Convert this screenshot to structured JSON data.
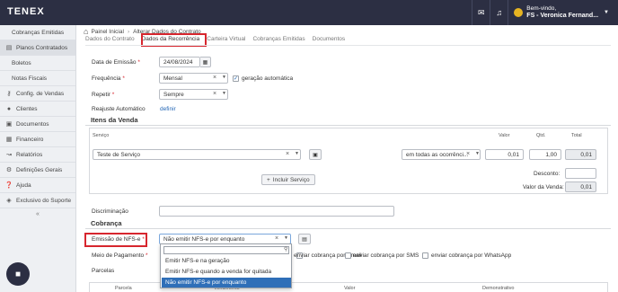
{
  "header": {
    "logo": "TENEX",
    "user": {
      "greeting": "Bem-vindo,",
      "name": "FS - Veronica Fernand..."
    }
  },
  "sidebar": {
    "items": [
      {
        "label": "Cobranças Emitidas",
        "icon": ""
      },
      {
        "label": "Planos Contratados",
        "icon": "subscriptions-icon"
      },
      {
        "label": "Boletos",
        "icon": ""
      },
      {
        "label": "Notas Fiscais",
        "icon": ""
      },
      {
        "label": "Config. de Vendas",
        "icon": "key-icon"
      },
      {
        "label": "Clientes",
        "icon": "user-icon"
      },
      {
        "label": "Documentos",
        "icon": "document-icon"
      },
      {
        "label": "Financeiro",
        "icon": "finance-icon"
      },
      {
        "label": "Relatórios",
        "icon": "chart-icon"
      },
      {
        "label": "Definições Gerais",
        "icon": "gears-icon"
      },
      {
        "label": "Ajuda",
        "icon": "help-icon"
      },
      {
        "label": "Exclusivo do Suporte",
        "icon": "shield-icon"
      }
    ],
    "collapse": "«"
  },
  "breadcrumb": {
    "home": "Painel Inicial",
    "current": "Alterar Dados do Contrato"
  },
  "tabs": [
    "Dados do Contrato",
    "Dados da Recorrência",
    "Carteira Virtual",
    "Cobranças Emitidas",
    "Documentos"
  ],
  "form": {
    "emissao": {
      "label": "Data de Emissão",
      "value": "24/08/2024"
    },
    "frequencia": {
      "label": "Frequência",
      "value": "Mensal",
      "auto_label": "geração automática"
    },
    "repetir": {
      "label": "Repetir",
      "value": "Sempre"
    },
    "reajuste": {
      "label": "Reajuste Automático",
      "link": "definir"
    }
  },
  "itens": {
    "title": "Itens da Venda",
    "headers": {
      "servico": "Serviço",
      "valor": "Valor",
      "qtd": "Qtd.",
      "total": "Total"
    },
    "row": {
      "servico": "Teste de Serviço",
      "ocorrencias": "em todas as ocorrênci...",
      "valor": "0,01",
      "qtd": "1,00",
      "total": "0,01"
    },
    "add_button": "Incluir Serviço",
    "desconto_label": "Desconto:",
    "desconto_value": "",
    "valor_venda_label": "Valor da Venda:",
    "valor_venda": "0,01"
  },
  "discriminacao": {
    "label": "Discriminação",
    "value": ""
  },
  "cobranca": {
    "title": "Cobrança",
    "nfse_label": "Emissão de NFS-e",
    "nfse_value": "Não emitir NFS-e por enquanto",
    "meio_label": "Meio de Pagamento",
    "email_label": "enviar cobrança por Email",
    "sms_label": "enviar cobrança por SMS",
    "whatsapp_label": "enviar cobrança por WhatsApp",
    "parcelas_label": "Parcelas",
    "parcelas_headers": {
      "parcela": "Parcela",
      "vencimento": "Vencimento",
      "valor": "Valor",
      "demonstrativo": "Demonstrativo"
    }
  },
  "dropdown": {
    "search_value": "",
    "options": [
      "Emitir NFS-e na geração",
      "Emitir NFS-e quando a venda for quitada",
      "Não emitir NFS-e por enquanto"
    ]
  },
  "colors": {
    "topbar": "#2c2f43",
    "highlight": "#d7262e",
    "link": "#2366b5",
    "selected": "#2f6fb8"
  }
}
